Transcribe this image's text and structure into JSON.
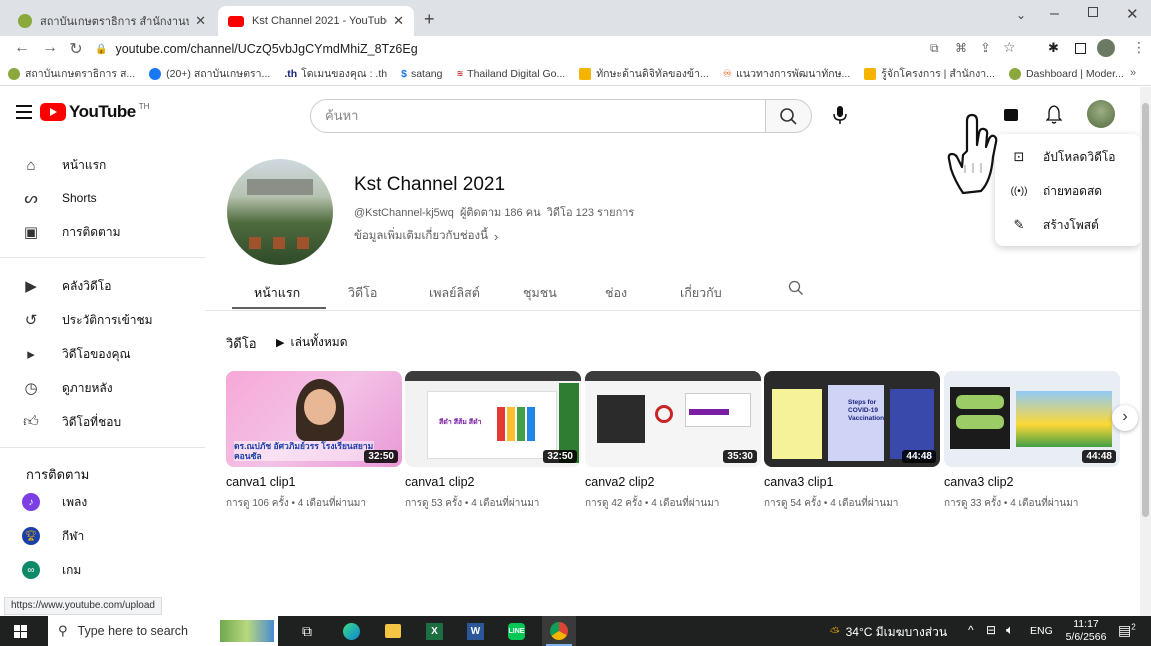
{
  "browser": {
    "tabs": [
      {
        "title": "สถาบันเกษตราธิการ สำนักงานปลัดกระ",
        "active": false
      },
      {
        "title": "Kst Channel 2021 - YouTube",
        "active": true
      }
    ],
    "url": "youtube.com/channel/UCzQ5vbJgCYmdMhiZ_8Tz6Eg",
    "bookmarks": [
      "สถาบันเกษตราธิการ ส...",
      "(20+) สถาบันเกษตรา...",
      "โดเมนของคุณ : .th",
      "satang",
      "Thailand Digital Go...",
      "ทักษะด้านดิจิทัลของข้า...",
      "แนวทางการพัฒนาทักษ...",
      "รู้จักโครงการ | สำนักงา...",
      "Dashboard | Moder..."
    ],
    "more_bookmarks": "»",
    "status_url": "https://www.youtube.com/upload"
  },
  "youtube": {
    "logo_text": "YouTube",
    "logo_region": "TH",
    "search_placeholder": "ค้นหา",
    "sidebar": {
      "main": [
        {
          "label": "หน้าแรก",
          "icon": "home-icon"
        },
        {
          "label": "Shorts",
          "icon": "shorts-icon"
        },
        {
          "label": "การติดตาม",
          "icon": "subscriptions-icon"
        }
      ],
      "library": [
        {
          "label": "คลังวิดีโอ",
          "icon": "library-icon"
        },
        {
          "label": "ประวัติการเข้าชม",
          "icon": "history-icon"
        },
        {
          "label": "วิดีโอของคุณ",
          "icon": "your-videos-icon"
        },
        {
          "label": "ดูภายหลัง",
          "icon": "watch-later-icon"
        },
        {
          "label": "วิดีโอที่ชอบ",
          "icon": "liked-icon"
        }
      ],
      "subscriptions_heading": "การติดตาม",
      "subscriptions": [
        {
          "label": "เพลง",
          "color": "#7b3fe4"
        },
        {
          "label": "กีฬา",
          "color": "#1a3fa8"
        },
        {
          "label": "เกม",
          "color": "#0d8a6a"
        }
      ]
    },
    "channel": {
      "name": "Kst Channel 2021",
      "handle": "@KstChannel-kj5wq",
      "subscribers": "ผู้ติดตาม 186 คน",
      "videos_count": "วิดีโอ 123 รายการ",
      "more_info": "ข้อมูลเพิ่มเติมเกี่ยวกับช่องนี้"
    },
    "tabs": [
      "หน้าแรก",
      "วิดีโอ",
      "เพลย์ลิสต์",
      "ชุมชน",
      "ช่อง",
      "เกี่ยวกับ"
    ],
    "section": {
      "title": "วิดีโอ",
      "play_all": "เล่นทั้งหมด"
    },
    "videos": [
      {
        "title": "canva1 clip1",
        "meta": "การดู 106 ครั้ง • 4 เดือนที่ผ่านมา",
        "duration": "32:50",
        "thumb_text": "ดร.ณปภัช อัศวภิมย์วรร โรงเรียนสยามคอนซัล"
      },
      {
        "title": "canva1 clip2",
        "meta": "การดู 53 ครั้ง • 4 เดือนที่ผ่านมา",
        "duration": "32:50",
        "thumb_text": "สีดำ สีส้ม สีดำ"
      },
      {
        "title": "canva2 clip2",
        "meta": "การดู 42 ครั้ง • 4 เดือนที่ผ่านมา",
        "duration": "35:30",
        "thumb_text": ""
      },
      {
        "title": "canva3 clip1",
        "meta": "การดู 54 ครั้ง • 4 เดือนที่ผ่านมา",
        "duration": "44:48",
        "thumb_text": "Steps for COVID-19 Vaccination"
      },
      {
        "title": "canva3 clip2",
        "meta": "การดู 33 ครั้ง • 4 เดือนที่ผ่านมา",
        "duration": "44:48",
        "thumb_text": ""
      }
    ],
    "create_menu": [
      {
        "label": "อัปโหลดวิดีโอ",
        "icon": "upload-video-icon"
      },
      {
        "label": "ถ่ายทอดสด",
        "icon": "live-icon"
      },
      {
        "label": "สร้างโพสต์",
        "icon": "create-post-icon"
      }
    ]
  },
  "taskbar": {
    "search_placeholder": "Type here to search",
    "weather": "34°C มีเมฆบางส่วน",
    "lang": "ENG",
    "time": "11:17",
    "date": "5/6/2566",
    "notif_count": "2"
  }
}
